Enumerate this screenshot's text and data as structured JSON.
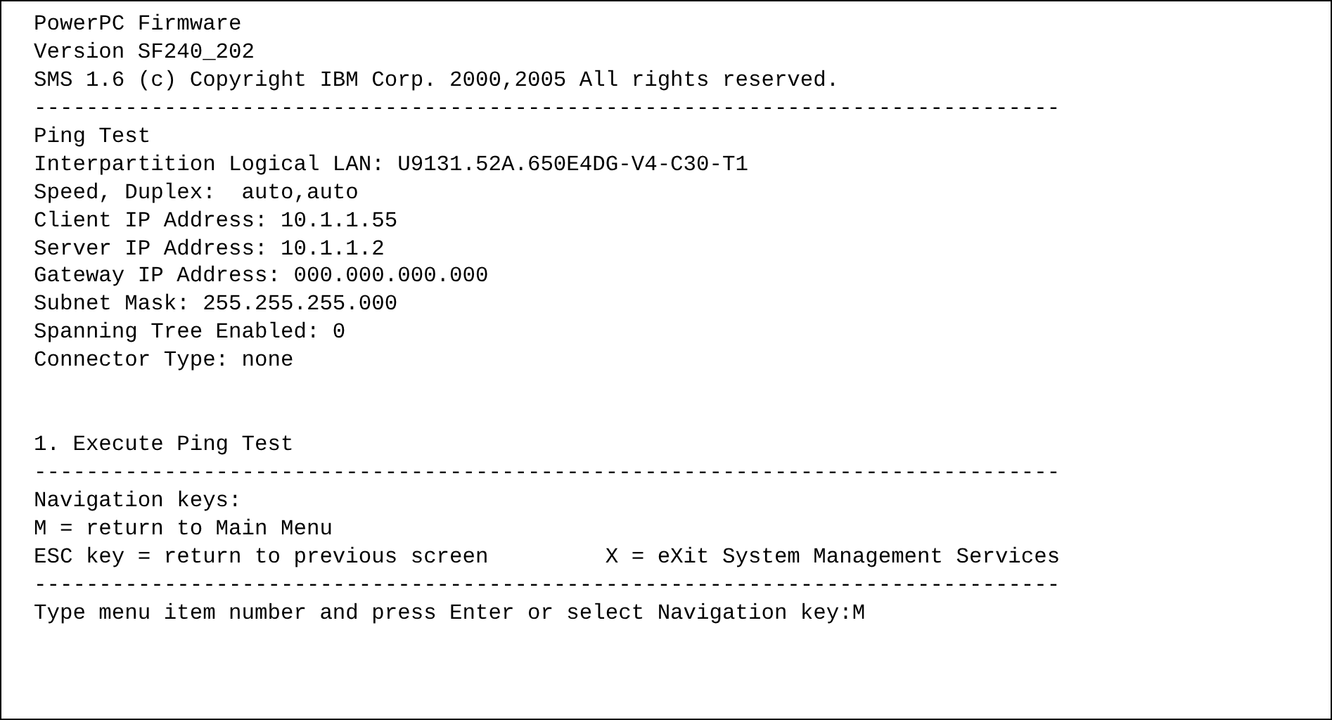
{
  "header": [
    "PowerPC Firmware",
    "Version SF240_202",
    "SMS 1.6 (c) Copyright IBM Corp. 2000,2005 All rights reserved."
  ],
  "separator_top": "-------------------------------------------------------------------------------",
  "title": "Ping Test",
  "settings": [
    "Interpartition Logical LAN: U9131.52A.650E4DG-V4-C30-T1",
    "Speed, Duplex:  auto,auto",
    "Client IP Address: 10.1.1.55",
    "Server IP Address: 10.1.1.2",
    "Gateway IP Address: 000.000.000.000",
    "Subnet Mask: 255.255.255.000",
    "Spanning Tree Enabled: 0",
    "Connector Type: none"
  ],
  "menu_items": [
    "1. Execute Ping Test"
  ],
  "separator_middle": "-------------------------------------------------------------------------------",
  "navigation": {
    "title": "Navigation keys:",
    "keys": [
      "M = return to Main Menu",
      "ESC key = return to previous screen",
      "X = eXit System Management Services"
    ]
  },
  "separator_bottom": "-------------------------------------------------------------------------------",
  "prompt": {
    "label": "Type menu item number and press Enter or select Navigation key:",
    "value": "M"
  }
}
